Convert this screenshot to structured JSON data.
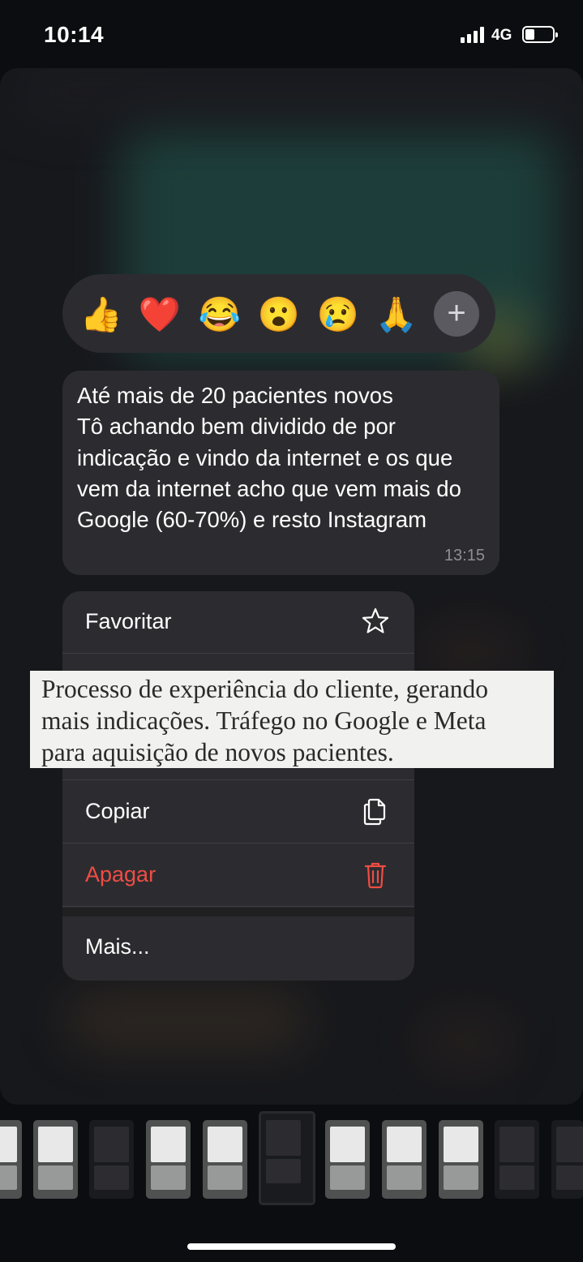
{
  "status": {
    "time": "10:14",
    "network": "4G",
    "battery_level": 0.35
  },
  "reactions": [
    {
      "emoji": "👍",
      "name": "thumbs-up"
    },
    {
      "emoji": "❤️",
      "name": "heart"
    },
    {
      "emoji": "😂",
      "name": "laughing"
    },
    {
      "emoji": "😮",
      "name": "surprised"
    },
    {
      "emoji": "😢",
      "name": "crying"
    },
    {
      "emoji": "🙏",
      "name": "praying-hands"
    }
  ],
  "reaction_add": "+",
  "message": {
    "text": "Até mais de 20 pacientes novos\nTô achando bem dividido de por indicação e vindo da internet e os que vem da internet acho que vem mais do Google (60-70%) e resto Instagram",
    "time": "13:15"
  },
  "menu": {
    "favoritar": "Favoritar",
    "copiar": "Copiar",
    "apagar": "Apagar",
    "mais": "Mais...",
    "danger_color": "#ef4d44"
  },
  "caption": {
    "line1": "Processo de experiência do cliente, gerando",
    "line2": "mais indicações. Tráfego no Google e Meta",
    "line3": "para aquisição de novos pacientes."
  },
  "colors": {
    "background": "#0c0d10",
    "surface": "#2c2c30",
    "secondary_text": "#8e8e94"
  }
}
